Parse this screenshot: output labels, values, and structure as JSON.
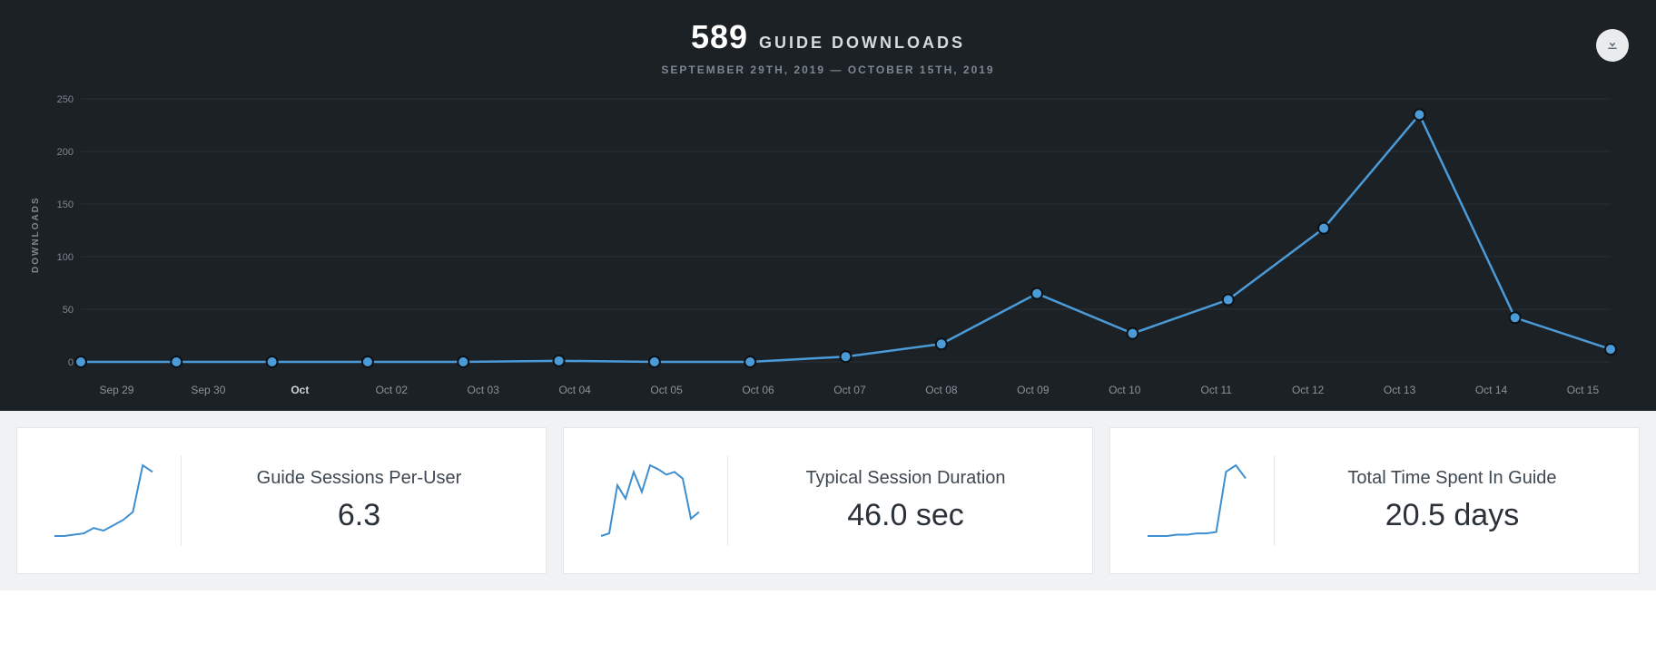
{
  "hero": {
    "total": "589",
    "label": "GUIDE DOWNLOADS",
    "date_range": "SEPTEMBER 29TH, 2019 — OCTOBER 15TH, 2019",
    "ylabel": "DOWNLOADS"
  },
  "chart_data": {
    "type": "line",
    "title": "Guide Downloads",
    "xlabel": "",
    "ylabel": "DOWNLOADS",
    "ylim": [
      0,
      250
    ],
    "yticks": [
      0,
      50,
      100,
      150,
      200,
      250
    ],
    "categories": [
      "Sep 29",
      "Sep 30",
      "Oct",
      "Oct 02",
      "Oct 03",
      "Oct 04",
      "Oct 05",
      "Oct 06",
      "Oct 07",
      "Oct 08",
      "Oct 09",
      "Oct 10",
      "Oct 11",
      "Oct 12",
      "Oct 13",
      "Oct 14",
      "Oct 15"
    ],
    "bold_categories": [
      "Oct"
    ],
    "values": [
      0,
      0,
      0,
      0,
      0,
      1,
      0,
      0,
      5,
      17,
      65,
      27,
      59,
      127,
      235,
      42,
      12
    ]
  },
  "cards": [
    {
      "label": "Guide Sessions Per-User",
      "value": "6.3",
      "spark": [
        2,
        2,
        3,
        4,
        8,
        6,
        10,
        14,
        20,
        55,
        50
      ]
    },
    {
      "label": "Typical Session Duration",
      "value": "46.0 sec",
      "spark": [
        2,
        4,
        40,
        30,
        50,
        35,
        55,
        52,
        48,
        50,
        45,
        15,
        20
      ]
    },
    {
      "label": "Total Time Spent In Guide",
      "value": "20.5 days",
      "spark": [
        1,
        1,
        1,
        2,
        2,
        3,
        3,
        4,
        50,
        55,
        45
      ]
    }
  ],
  "colors": {
    "line": "#4b9bd8",
    "point_fill": "#4b9bd8",
    "point_stroke": "#1c2126",
    "grid": "#2a3036",
    "spark": "#3e8ed0"
  }
}
